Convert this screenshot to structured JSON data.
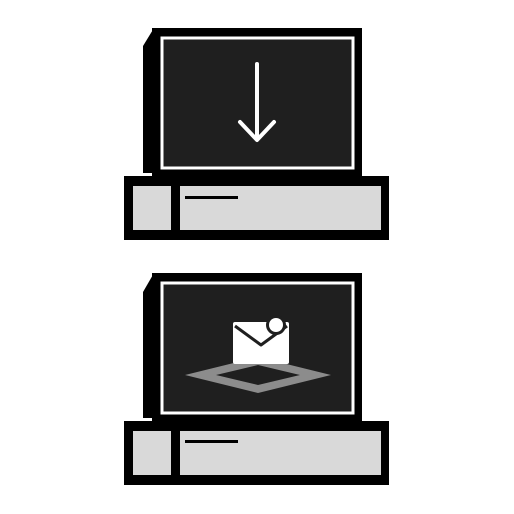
{
  "icons": [
    {
      "name": "computer-download-icon",
      "screen_glyph": "download-arrow-icon"
    },
    {
      "name": "computer-mail-notification-icon",
      "screen_glyph": "mail-notification-icon"
    }
  ],
  "colors": {
    "background": "#ffffff",
    "outline": "#000000",
    "screen": "#1f1f1f",
    "screen_border": "#ffffff",
    "base_fill": "#d9d9d9",
    "envelope": "#ffffff",
    "envelope_shadow": "#8c8c8c"
  }
}
